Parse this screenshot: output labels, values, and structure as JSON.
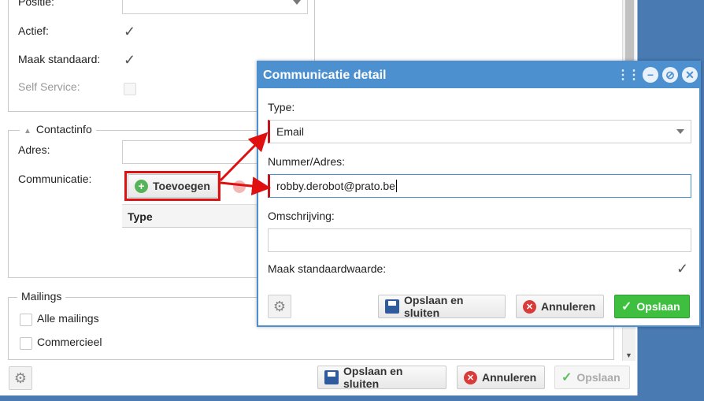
{
  "background_form": {
    "positie_label": "Positie:",
    "actief_label": "Actief:",
    "maak_standaard_label": "Maak standaard:",
    "self_service_label": "Self Service:",
    "contactinfo_legend": "Contactinfo",
    "adres_label": "Adres:",
    "communicatie_label": "Communicatie:",
    "toevoegen_label": "Toevoegen",
    "grid_type_header": "Type",
    "mailings_legend": "Mailings",
    "alle_mailings_label": "Alle mailings",
    "commercieel_label": "Commercieel",
    "save_close_label": "Opslaan en sluiten",
    "cancel_label": "Annuleren",
    "save_label": "Opslaan"
  },
  "dialog": {
    "title": "Communicatie detail",
    "type_label": "Type:",
    "type_value": "Email",
    "nummer_label": "Nummer/Adres:",
    "nummer_value": "robby.derobot@prato.be",
    "omschrijving_label": "Omschrijving:",
    "omschrijving_value": "",
    "maak_standaardwaarde_label": "Maak standaardwaarde:",
    "save_close_label": "Opslaan en sluiten",
    "cancel_label": "Annuleren",
    "save_label": "Opslaan"
  },
  "colors": {
    "dialog_accent": "#4d90d0",
    "highlight": "#e01010",
    "primary_button": "#3fbf3f",
    "required_marker": "#c0161e"
  },
  "icons": {
    "gear": "gear-icon",
    "save": "floppy-icon",
    "cancel": "cancel-icon",
    "check": "check-icon",
    "add": "add-icon",
    "minimize": "minimize-icon",
    "maximize": "maximize-icon",
    "close": "close-icon"
  }
}
